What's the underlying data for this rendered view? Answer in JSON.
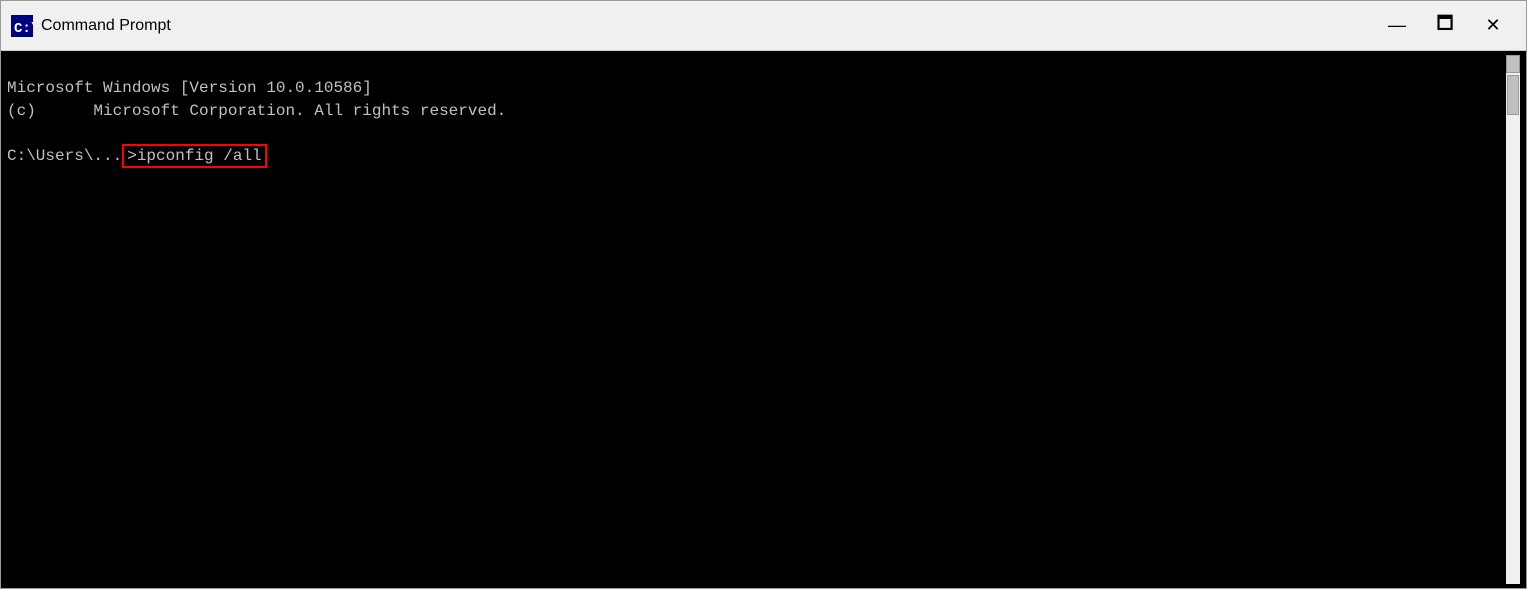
{
  "window": {
    "title": "Command Prompt",
    "icon_label": "cmd-icon"
  },
  "controls": {
    "minimize_label": "—",
    "maximize_label": "🗖",
    "close_label": "✕"
  },
  "terminal": {
    "line1": "Microsoft Windows [Version 10.0.10586]",
    "line2": "(c)      Microsoft Corporation. All rights reserved.",
    "line3": "",
    "prompt": "C:\\Users\\...",
    "command": ">ipconfig /all"
  },
  "colors": {
    "terminal_bg": "#000000",
    "terminal_text": "#c0c0c0",
    "highlight_border": "#ff0000",
    "titlebar_bg": "#f0f0f0"
  }
}
